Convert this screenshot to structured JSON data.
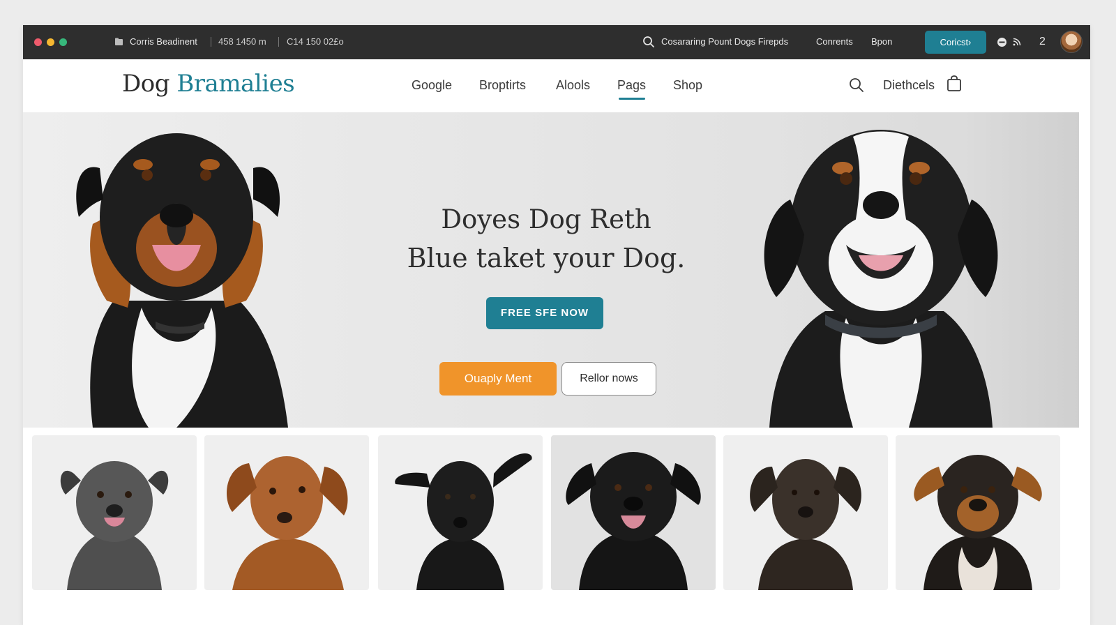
{
  "topbar": {
    "account_label": "Corris Beadinent",
    "stat_a": "458 1450 m",
    "stat_b": "C14 150 02£o",
    "search_text": "Cosararing Pount Dogs Firepds",
    "link_contents": "Conrents",
    "link_bpon": "Bpon",
    "contact_button": "Coricst›",
    "count": "2"
  },
  "navbar": {
    "logo_word1": "Dog",
    "logo_word2": "Bramalies",
    "items": [
      "Google",
      "Broptirts",
      "Alools",
      "Pags",
      "Shop"
    ],
    "active_item": "Pags",
    "account_link": "Diethcels"
  },
  "hero": {
    "title_line1": "Doyes Dog Reth",
    "title_line2": "Blue taket your Dog.",
    "cta_button": "FREE SFE NOW",
    "primary_button": "Ouaply Ment",
    "secondary_button": "Rellor nows"
  },
  "colors": {
    "accent": "#1f7f93",
    "orange": "#f0942a",
    "topbar": "#2e2e2e"
  },
  "icons": [
    "dot-red",
    "dot-yellow",
    "dot-green",
    "folder-icon",
    "search-icon",
    "globe-icon",
    "rss-icon",
    "avatar",
    "search-icon",
    "bag-icon"
  ]
}
